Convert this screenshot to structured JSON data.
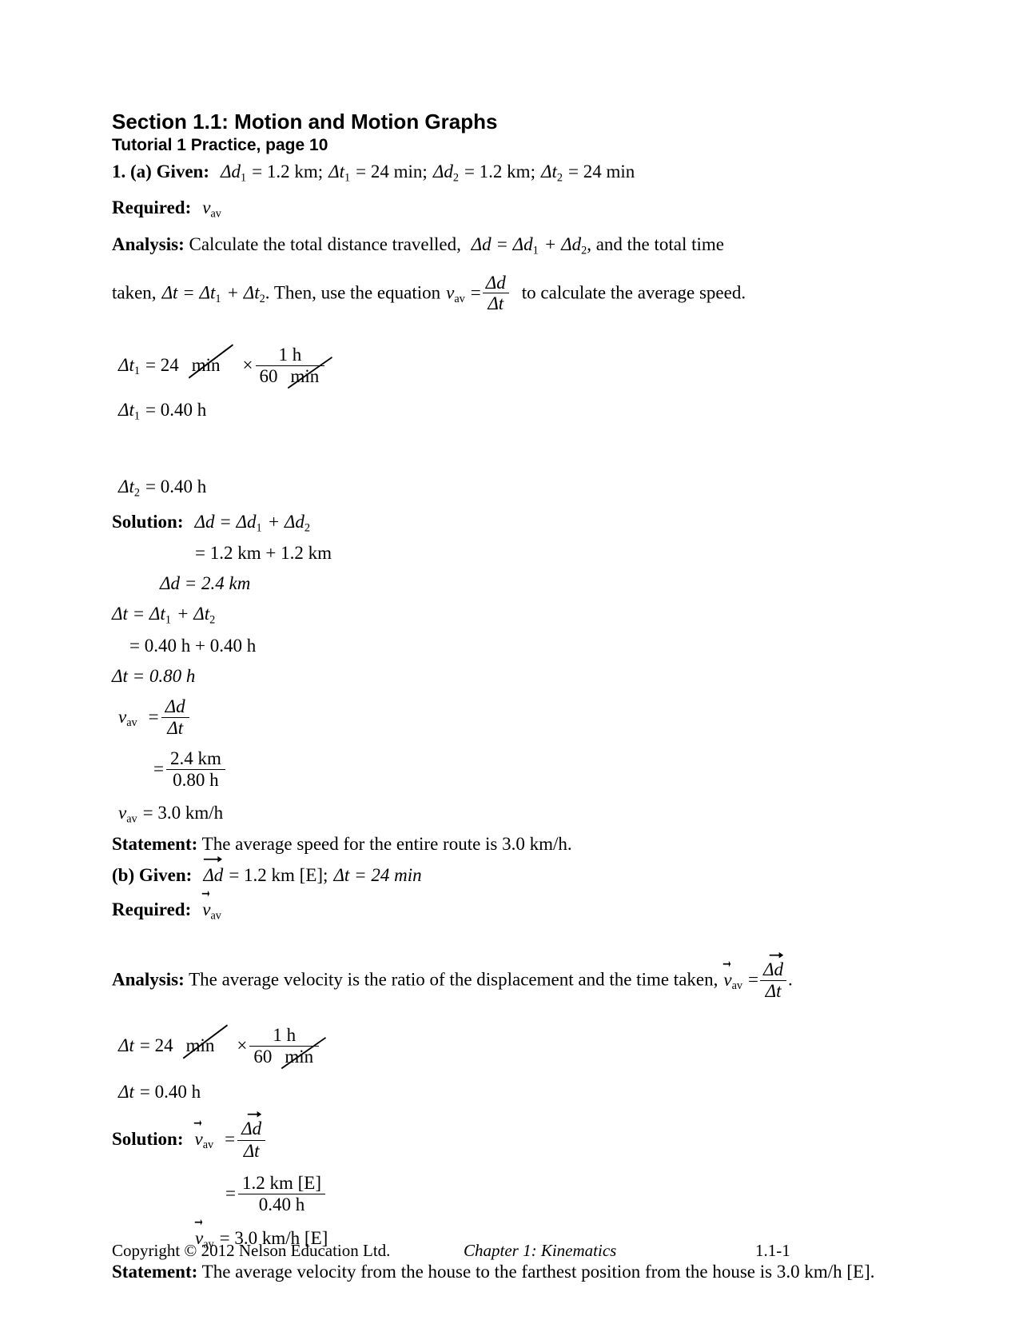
{
  "document": {
    "section_title": "Section 1.1: Motion and Motion Graphs",
    "subsection_title": "Tutorial 1 Practice, page 10"
  },
  "part_a": {
    "item_label": "1. (a) Given:",
    "given": {
      "d1_sym": "Δd",
      "d1_sub": "1",
      "d1_eq": "= 1.2 km;",
      "t1_sym": "Δt",
      "t1_sub": "1",
      "t1_eq": "= 24 min;",
      "d2_sym": "Δd",
      "d2_sub": "2",
      "d2_eq": "= 1.2 km;",
      "t2_sym": "Δt",
      "t2_sub": "2",
      "t2_eq": "= 24 min"
    },
    "required_label": "Required:",
    "required_sym": "v",
    "required_sub": "av",
    "analysis_label": "Analysis:",
    "analysis_text1": "Calculate the total distance travelled,",
    "analysis_eq1": "Δd = Δd",
    "analysis_eq1_sub1": "1",
    "analysis_eq1_plus": "+ Δd",
    "analysis_eq1_sub2": "2",
    "analysis_text2": ", and the total time",
    "analysis_text3": "taken,",
    "analysis_eq2": "Δt = Δt",
    "analysis_eq2_sub1": "1",
    "analysis_eq2_plus": "+ Δt",
    "analysis_eq2_sub2": "2",
    "analysis_text4": ". Then, use the equation",
    "analysis_v": "v",
    "analysis_v_sub": "av",
    "analysis_eq3": "=",
    "analysis_frac_num": "Δd",
    "analysis_frac_den": "Δt",
    "analysis_text5": "to calculate the average speed.",
    "conv1": {
      "lhs": "Δt",
      "lhs_sub": "1",
      "eq": "= 24",
      "unit_cancel": "min",
      "times": "×",
      "num": "1 h",
      "den_num": "60",
      "den_unit": "min"
    },
    "t1_result": {
      "sym": "Δt",
      "sub": "1",
      "val": "= 0.40 h"
    },
    "t2_result": {
      "sym": "Δt",
      "sub": "2",
      "val": "= 0.40 h"
    },
    "solution_label": "Solution:",
    "sol_line1": "Δd = Δd",
    "sol_line1_sub1": "1",
    "sol_line1_plus": "+ Δd",
    "sol_line1_sub2": "2",
    "sol_line2": "= 1.2 km + 1.2 km",
    "sol_line3": "Δd = 2.4 km",
    "sol_line4": "Δt = Δt",
    "sol_line4_sub1": "1",
    "sol_line4_plus": "+ Δt",
    "sol_line4_sub2": "2",
    "sol_line5": "= 0.40 h + 0.40 h",
    "sol_line6": "Δt = 0.80 h",
    "vav_sym": "v",
    "vav_sub": "av",
    "vav_eq": "=",
    "vav_frac_num": "Δd",
    "vav_frac_den": "Δt",
    "vav_eq2": "=",
    "vav_frac2_num": "2.4 km",
    "vav_frac2_den": "0.80 h",
    "vav_final_sym": "v",
    "vav_final_sub": "av",
    "vav_final_val": "= 3.0 km/h",
    "statement_label": "Statement:",
    "statement_text": "The average speed for the entire route is 3.0 km/h."
  },
  "part_b": {
    "item_label": "(b) Given:",
    "given_d_sym": "Δd",
    "given_d_eq": "= 1.2 km [E];",
    "given_t": "Δt = 24 min",
    "required_label": "Required:",
    "required_sym": "v",
    "required_sub": "av",
    "analysis_label": "Analysis:",
    "analysis_text": "The average velocity is the ratio of the displacement and the time taken,",
    "analysis_v": "v",
    "analysis_v_sub": "av",
    "analysis_eq": "=",
    "analysis_frac_num": "Δd",
    "analysis_frac_den": "Δt",
    "analysis_period": ".",
    "conv": {
      "lhs": "Δt",
      "eq": "= 24",
      "unit_cancel": "min",
      "times": "×",
      "num": "1 h",
      "den_num": "60",
      "den_unit": "min"
    },
    "t_result": {
      "sym": "Δt",
      "val": "= 0.40 h"
    },
    "solution_label": "Solution:",
    "sol_v_sym": "v",
    "sol_v_sub": "av",
    "sol_eq": "=",
    "sol_frac_num": "Δd",
    "sol_frac_den": "Δt",
    "sol_eq2": "=",
    "sol_frac2_num": "1.2 km [E]",
    "sol_frac2_den": "0.40 h",
    "sol_final_sym": "v",
    "sol_final_sub": "av",
    "sol_final_val": "= 3.0 km/h [E]",
    "statement_label": "Statement:",
    "statement_text": "The average velocity from the house to the farthest position from the house is 3.0 km/h [E]."
  },
  "footer": {
    "copyright": "Copyright © 2012 Nelson Education Ltd.",
    "chapter": "Chapter 1: Kinematics",
    "page_number": "1.1-1"
  }
}
